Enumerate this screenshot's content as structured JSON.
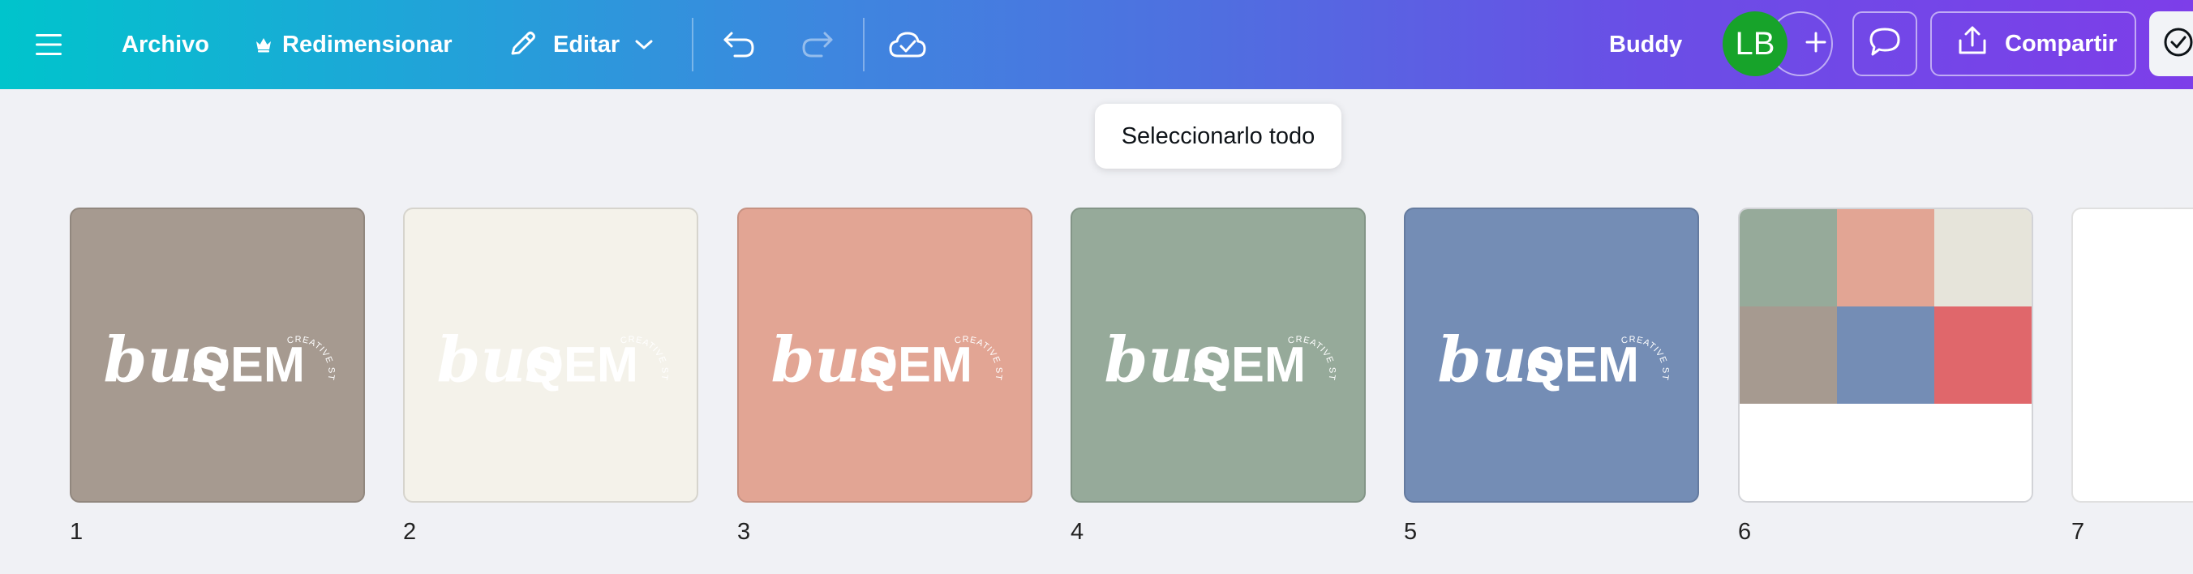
{
  "toolbar": {
    "menu_icon": "hamburger-menu-icon",
    "file_label": "Archivo",
    "resize_label": "Redimensionar",
    "resize_icon": "crown-icon",
    "edit_label": "Editar",
    "edit_icon": "pencil-icon",
    "undo_icon": "undo-icon",
    "redo_icon": "redo-icon",
    "save_status_icon": "cloud-check-icon",
    "project_name": "Buddy",
    "avatar_initials": "LB",
    "add_collaborator_icon": "plus-icon",
    "comments_icon": "comment-icon",
    "share_label": "Compartir",
    "share_icon": "upload-icon"
  },
  "tooltip": {
    "text": "Seleccionarlo todo"
  },
  "logo": {
    "script_text": "bus",
    "bold_text": "QEM",
    "arc_text": "CREATIVE STUDIO"
  },
  "pages": [
    {
      "number": "1",
      "background": "#a69a90",
      "logo_color": "#ffffff"
    },
    {
      "number": "2",
      "background": "#f4f2ea",
      "logo_color": "#ffffff"
    },
    {
      "number": "3",
      "background": "#e2a594",
      "logo_color": "#ffffff"
    },
    {
      "number": "4",
      "background": "#96aa9a",
      "logo_color": "#ffffff"
    },
    {
      "number": "5",
      "background": "#748db5",
      "logo_color": "#ffffff"
    },
    {
      "number": "6",
      "palette": [
        "#96aa9a",
        "#e2a594",
        "#e6e4da",
        "#a69a90",
        "#748db5",
        "#e0676b"
      ]
    },
    {
      "number": "7",
      "background": "#ffffff"
    }
  ]
}
